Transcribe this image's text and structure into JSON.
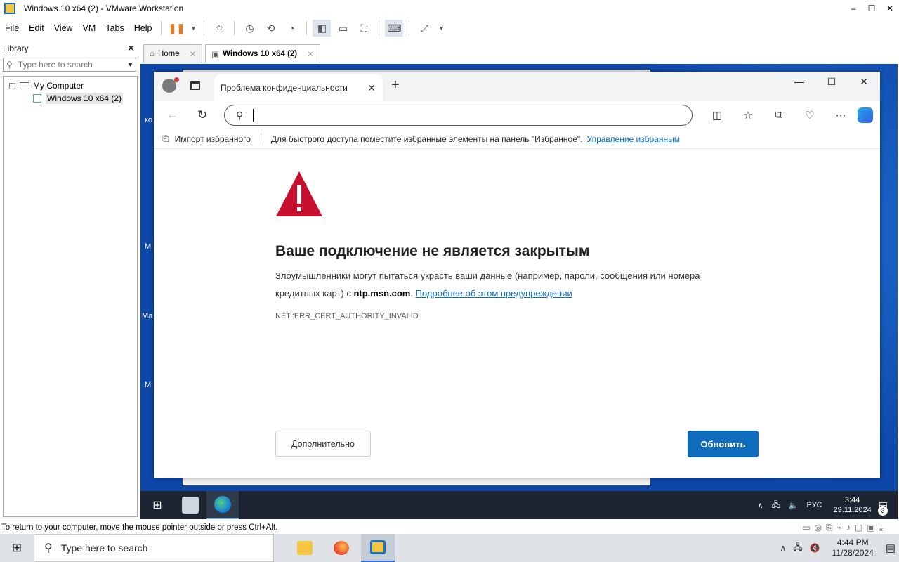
{
  "window": {
    "title": "Windows 10 x64 (2) - VMware Workstation",
    "controls": [
      "–",
      "☐",
      "✕"
    ]
  },
  "menu": [
    "File",
    "Edit",
    "View",
    "VM",
    "Tabs",
    "Help"
  ],
  "library": {
    "title": "Library",
    "close": "✕",
    "search_placeholder": "Type here to search",
    "tree": {
      "root": "My Computer",
      "expander": "−",
      "vm": "Windows 10 x64 (2)"
    }
  },
  "vm_tabs": [
    {
      "label": "Home",
      "close": "✕"
    },
    {
      "label": "Windows 10 x64 (2)",
      "close": "✕"
    }
  ],
  "guest": {
    "edge": {
      "tab_title": "Проблема конфиденциальности",
      "tab_close": "✕",
      "new_tab": "+",
      "win_controls": [
        "—",
        "☐",
        "✕"
      ],
      "address_value": "",
      "favorites_bar": {
        "import": "Импорт избранного",
        "hint": "Для быстрого доступа поместите избранные элементы на панель \"Избранное\".",
        "manage": "Управление избранным"
      },
      "error": {
        "title": "Ваше подключение не является закрытым",
        "body_prefix": "Злоумышленники могут пытаться украсть ваши данные (например, пароли, сообщения или номера кредитных карт) с ",
        "host": "ntp.msn.com",
        "body_suffix": ".",
        "learn_more": "Подробнее об этом предупреждении",
        "code": "NET::ERR_CERT_AUTHORITY_INVALID",
        "advanced_button": "Дополнительно",
        "reload_button": "Обновить"
      }
    },
    "desktop_labels": [
      "ко",
      "М",
      "Ма",
      "М"
    ],
    "taskbar": {
      "lang": "РУС",
      "time": "3:44",
      "date": "29.11.2024",
      "notifications": "3"
    }
  },
  "status_bar": {
    "text": "To return to your computer, move the mouse pointer outside or press Ctrl+Alt."
  },
  "host_taskbar": {
    "search_placeholder": "Type here to search",
    "time": "4:44 PM",
    "date": "11/28/2024"
  },
  "colors": {
    "edge_accent": "#0f6cbd",
    "warning_red": "#c8102e",
    "guest_desktop": "#0d47a8",
    "vmware_pause": "#e07b24"
  }
}
